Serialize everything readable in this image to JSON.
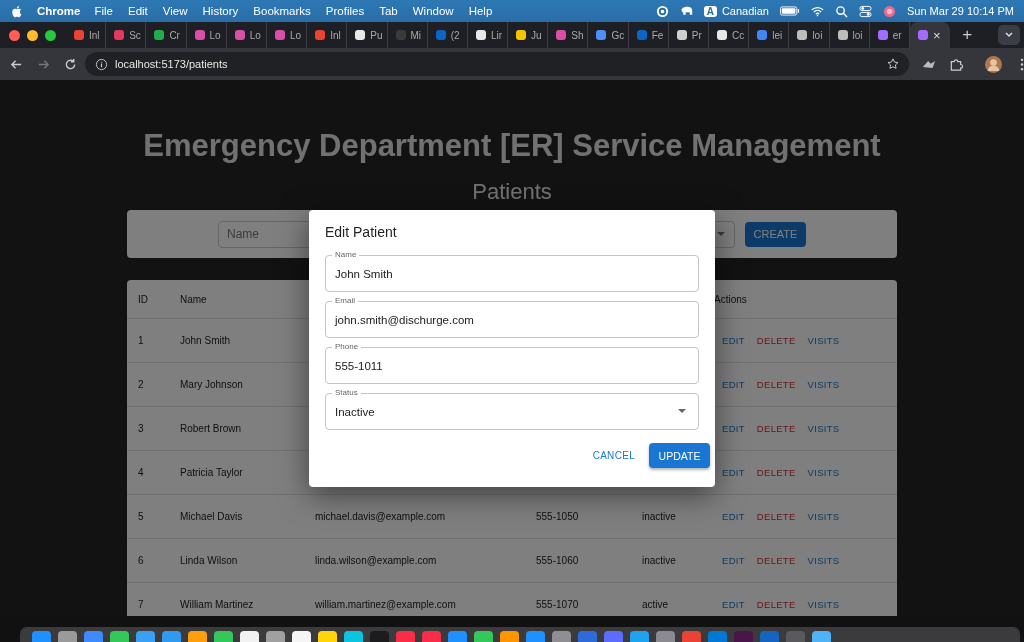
{
  "menu_bar": {
    "app": "Chrome",
    "items": [
      "File",
      "Edit",
      "View",
      "History",
      "Bookmarks",
      "Profiles",
      "Tab",
      "Window",
      "Help"
    ],
    "input_source_badge": "A",
    "input_source": "Canadian",
    "clock": "Sun Mar 29  10:14 PM"
  },
  "tabs": [
    {
      "label": "Inl",
      "color": "#ea4335",
      "selected": false
    },
    {
      "label": "Sc",
      "color": "#e03a5e",
      "selected": false
    },
    {
      "label": "Cr",
      "color": "#1fae4b",
      "selected": false
    },
    {
      "label": "Lo",
      "color": "#d94fa8",
      "selected": false
    },
    {
      "label": "Lo",
      "color": "#d94fa8",
      "selected": false
    },
    {
      "label": "Lo",
      "color": "#d94fa8",
      "selected": false
    },
    {
      "label": "Inl",
      "color": "#ea4335",
      "selected": false
    },
    {
      "label": "Pu",
      "color": "#e8e8e8",
      "selected": false
    },
    {
      "label": "Mi",
      "color": "#3a3a3a",
      "selected": false
    },
    {
      "label": "(2",
      "color": "#0a66c2",
      "selected": false
    },
    {
      "label": "Lir",
      "color": "#e8e8e8",
      "selected": false
    },
    {
      "label": "Ju",
      "color": "#f5c400",
      "selected": false
    },
    {
      "label": "Sh",
      "color": "#d94fa8",
      "selected": false
    },
    {
      "label": "Gc",
      "color": "#4f8ff7",
      "selected": false
    },
    {
      "label": "Fe",
      "color": "#0a66c2",
      "selected": false
    },
    {
      "label": "Pr",
      "color": "#cfcfcf",
      "selected": false
    },
    {
      "label": "Cc",
      "color": "#e8e8e8",
      "selected": false
    },
    {
      "label": "lei",
      "color": "#4285f4",
      "selected": false
    },
    {
      "label": "loi",
      "color": "#bdbdbd",
      "selected": false
    },
    {
      "label": "loi",
      "color": "#bdbdbd",
      "selected": false
    },
    {
      "label": "er",
      "color": "#a46bff",
      "selected": false
    },
    {
      "label": "×",
      "color": "#a46bff",
      "selected": true
    }
  ],
  "new_tab": "+",
  "address": "localhost:5173/patients",
  "page": {
    "title": "Emergency Department [ER] Service Management",
    "subtitle": "Patients",
    "filter": {
      "name_placeholder": "Name",
      "create": "CREATE"
    },
    "header": {
      "id": "ID",
      "name": "Name",
      "actions": "Actions"
    },
    "rows": [
      {
        "id": "1",
        "name": "John Smith",
        "actions": [
          {
            "kind": "edit",
            "label": "EDIT"
          },
          {
            "kind": "delete",
            "label": "DELETE"
          },
          {
            "kind": "visits",
            "label": "VISITS"
          }
        ]
      },
      {
        "id": "2",
        "name": "Mary Johnson",
        "actions": [
          {
            "kind": "edit",
            "label": "EDIT"
          },
          {
            "kind": "delete",
            "label": "DELETE"
          },
          {
            "kind": "visits",
            "label": "VISITS"
          }
        ]
      },
      {
        "id": "3",
        "name": "Robert Brown",
        "actions": [
          {
            "kind": "edit",
            "label": "EDIT"
          },
          {
            "kind": "delete",
            "label": "DELETE"
          },
          {
            "kind": "visits",
            "label": "VISITS"
          }
        ]
      },
      {
        "id": "4",
        "name": "Patricia Taylor",
        "actions": [
          {
            "kind": "edit",
            "label": "EDIT"
          },
          {
            "kind": "delete",
            "label": "DELETE"
          },
          {
            "kind": "visits",
            "label": "VISITS"
          }
        ]
      },
      {
        "id": "5",
        "name": "Michael Davis",
        "email": "michael.davis@example.com",
        "phone": "555-1050",
        "status": "inactive",
        "actions": [
          {
            "kind": "edit",
            "label": "EDIT"
          },
          {
            "kind": "delete",
            "label": "DELETE"
          },
          {
            "kind": "visits",
            "label": "VISITS"
          }
        ]
      },
      {
        "id": "6",
        "name": "Linda Wilson",
        "email": "linda.wilson@example.com",
        "phone": "555-1060",
        "status": "inactive",
        "actions": [
          {
            "kind": "edit",
            "label": "EDIT"
          },
          {
            "kind": "delete",
            "label": "DELETE"
          },
          {
            "kind": "visits",
            "label": "VISITS"
          }
        ]
      },
      {
        "id": "7",
        "name": "William Martinez",
        "email": "william.martinez@example.com",
        "phone": "555-1070",
        "status": "active",
        "actions": [
          {
            "kind": "edit",
            "label": "EDIT"
          },
          {
            "kind": "delete",
            "label": "DELETE"
          },
          {
            "kind": "visits",
            "label": "VISITS"
          }
        ]
      }
    ]
  },
  "dialog": {
    "title": "Edit Patient",
    "fields": [
      {
        "kind": "text",
        "label": "Name",
        "value": "John Smith"
      },
      {
        "kind": "text",
        "label": "Email",
        "value": "john.smith@dischurge.com"
      },
      {
        "kind": "text",
        "label": "Phone",
        "value": "555-1011"
      },
      {
        "kind": "select",
        "label": "Status",
        "value": "Inactive"
      }
    ],
    "cancel": "CANCEL",
    "update": "UPDATE"
  },
  "dock": [
    {
      "color": "#1e90ff"
    },
    {
      "color": "#9a9a9a"
    },
    {
      "color": "#3d8bfd"
    },
    {
      "color": "#34c759"
    },
    {
      "color": "#3aa0f3"
    },
    {
      "color": "#2f9bf0"
    },
    {
      "color": "#ff9f0a"
    },
    {
      "color": "#34c759"
    },
    {
      "color": "#f2f2f2"
    },
    {
      "color": "#a0a0a0"
    },
    {
      "color": "#f5f5f5"
    },
    {
      "color": "#ffd60a"
    },
    {
      "color": "#0ac4e0"
    },
    {
      "color": "#1c1c1e"
    },
    {
      "color": "#fa2d48"
    },
    {
      "color": "#fa2d48"
    },
    {
      "color": "#1e90ff"
    },
    {
      "color": "#34c759"
    },
    {
      "color": "#ff9500"
    },
    {
      "color": "#1e90ff"
    },
    {
      "color": "#8e8e93"
    },
    {
      "color": "#2f6bd8"
    },
    {
      "color": "#5b6cff"
    },
    {
      "color": "#1fa3f0"
    },
    {
      "color": "#8a8a90"
    },
    {
      "color": "#ea4335"
    },
    {
      "color": "#0078d4"
    },
    {
      "color": "#4a154b"
    },
    {
      "color": "#1565c0"
    },
    {
      "color": "#5a5a5e"
    },
    {
      "color": "#4fb3f6"
    }
  ]
}
